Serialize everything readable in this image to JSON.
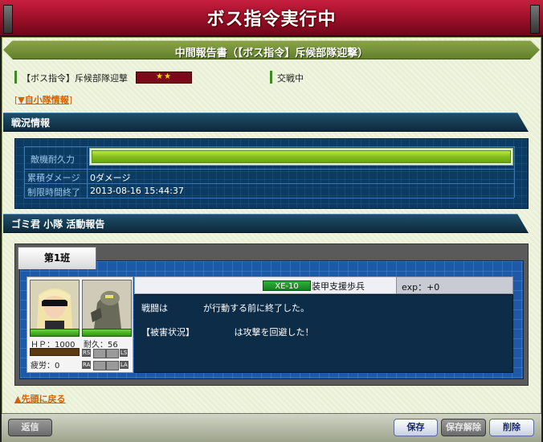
{
  "banner": {
    "title": "ボス指令実行中"
  },
  "report": {
    "title": "中間報告書（【ボス指令】斥候部隊迎撃）"
  },
  "mission": {
    "name": "【ボス指令】斥候部隊迎撃",
    "stars": "★★",
    "state": "交戦中"
  },
  "links": {
    "own_squad_open": "[",
    "own_squad": "▼自小隊情報",
    "own_squad_close": "]",
    "back_to_top": "▲先頭に戻る"
  },
  "battle_status": {
    "header": "戦況情報",
    "enemy_hp_label": "敵機耐久力",
    "enemy_hp_fraction": 1.0,
    "damage_label": "累積ダメージ",
    "damage_value": "0ダメージ",
    "time_limit_label": "制限時間終了",
    "time_limit_value": "2013-08-16 15:44:37"
  },
  "activity": {
    "header": "ゴミ君 小隊 活動報告",
    "tab_label": "第1班",
    "unit_code": "XE-10",
    "unit_type": "装甲支援歩兵",
    "exp": "exp：+0",
    "pilot_hp": "ＨＰ：1000",
    "fatigue": "疲労：0",
    "durability": "耐久：56",
    "slots": {
      "rs": "RS",
      "ls": "LS",
      "ra": "RA",
      "la": "LA"
    },
    "message1": "戦闘は　　　　が行動する前に終了した。",
    "message2": "【被害状況】　　　　　は攻撃を回避した！"
  },
  "buttons": {
    "reply": "返信",
    "save": "保存",
    "unsave": "保存解除",
    "delete": "削除"
  },
  "colors": {
    "banner": "#a8132f",
    "frame": "#e9f0d6",
    "status_bg": "#0b3a63",
    "hp_bar": "#86be1e",
    "accent_link": "#d36000"
  }
}
